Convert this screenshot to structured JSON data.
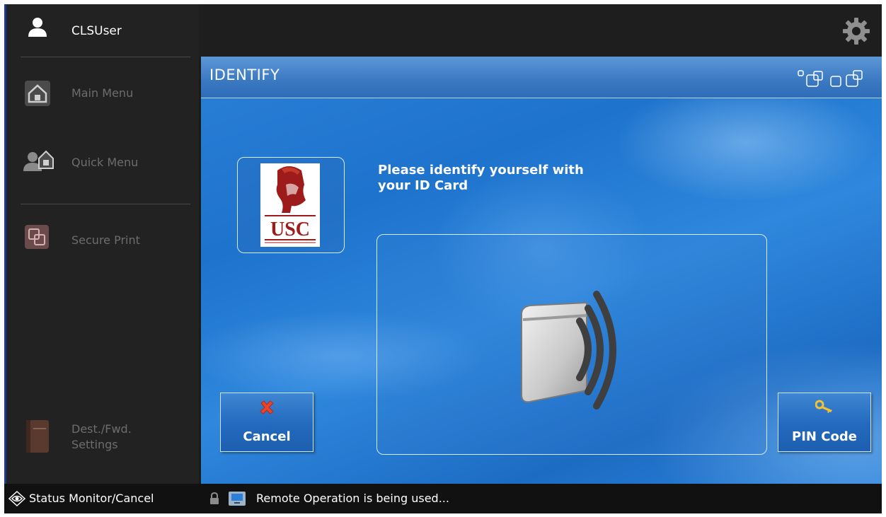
{
  "sidebar": {
    "user_name": "CLSUser",
    "items": [
      {
        "label": "Main Menu",
        "icon": "home-icon"
      },
      {
        "label": "Quick Menu",
        "icon": "quick-menu-icon"
      },
      {
        "label": "Secure Print",
        "icon": "secure-print-icon"
      },
      {
        "label": "Dest./Fwd.\nSettings",
        "icon": "address-book-icon"
      }
    ]
  },
  "topbar": {
    "settings_icon": "gear-icon"
  },
  "main": {
    "title": "IDENTIFY",
    "logo_text": "USC",
    "instruction": "Please identify yourself with\n your ID Card",
    "cancel_label": "Cancel",
    "pin_label": "PIN Code"
  },
  "statusbar": {
    "status_monitor_label": "Status Monitor/Cancel",
    "message": "Remote Operation is being used..."
  },
  "colors": {
    "sidebar_bg": "#222222",
    "accent_blue": "#2a7fd6",
    "cancel_x": "#e8452c",
    "key_yellow": "#f2c230"
  }
}
